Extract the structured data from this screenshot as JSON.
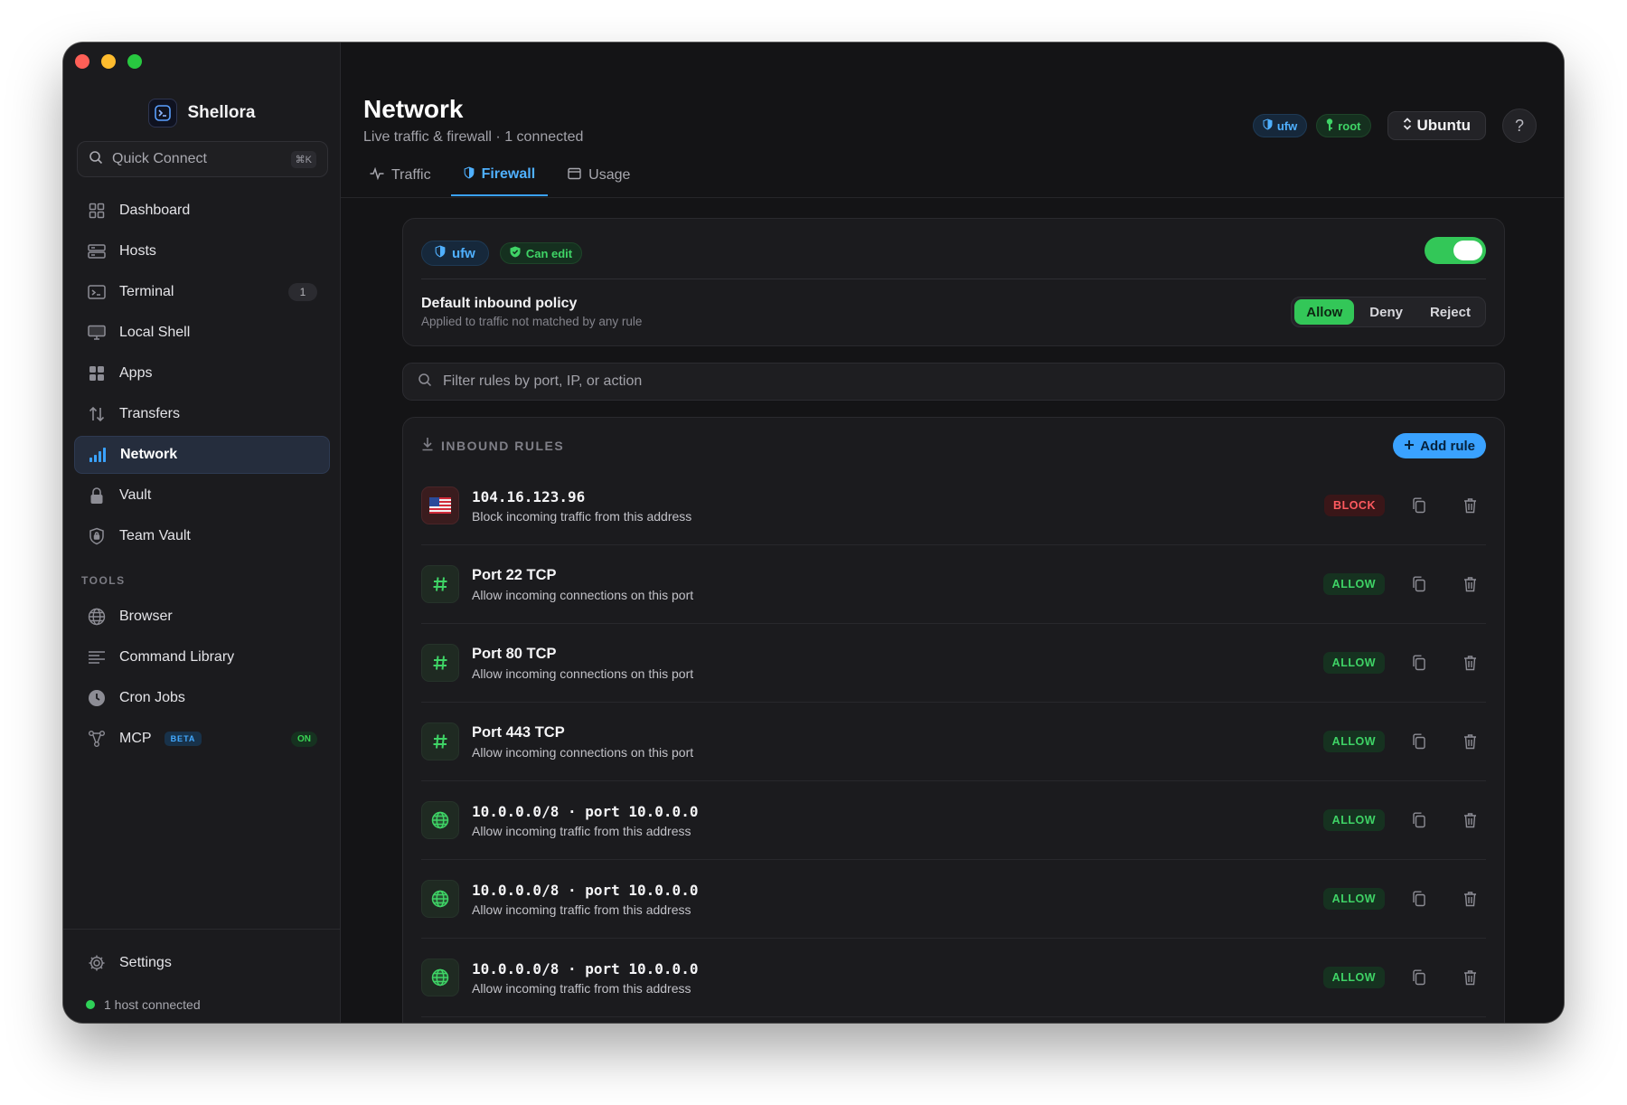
{
  "app": {
    "name": "Shellora"
  },
  "sidebar": {
    "quick_connect": {
      "label": "Quick Connect",
      "shortcut": "⌘K"
    },
    "items": [
      {
        "label": "Dashboard",
        "icon": "grid-icon"
      },
      {
        "label": "Hosts",
        "icon": "server-icon"
      },
      {
        "label": "Terminal",
        "icon": "terminal-icon",
        "count": "1"
      },
      {
        "label": "Local Shell",
        "icon": "monitor-icon"
      },
      {
        "label": "Apps",
        "icon": "apps-icon"
      },
      {
        "label": "Transfers",
        "icon": "transfer-icon"
      },
      {
        "label": "Network",
        "icon": "signal-bars-icon",
        "active": true
      },
      {
        "label": "Vault",
        "icon": "lock-icon"
      },
      {
        "label": "Team Vault",
        "icon": "shield-lock-icon"
      }
    ],
    "tools_header": "TOOLS",
    "tools": [
      {
        "label": "Browser",
        "icon": "globe-icon"
      },
      {
        "label": "Command Library",
        "icon": "list-icon"
      },
      {
        "label": "Cron Jobs",
        "icon": "clock-icon"
      },
      {
        "label": "MCP",
        "icon": "nodes-icon",
        "badge": "BETA",
        "status": "ON"
      }
    ],
    "settings_label": "Settings",
    "host_status": "1 host connected"
  },
  "header": {
    "title": "Network",
    "subtitle": "Live traffic & firewall · 1 connected",
    "ufw_pill": "ufw",
    "root_pill": "root",
    "os_label": "Ubuntu",
    "help_label": "?"
  },
  "tabs": [
    {
      "label": "Traffic",
      "icon": "pulse-icon"
    },
    {
      "label": "Firewall",
      "icon": "shield-icon",
      "active": true
    },
    {
      "label": "Usage",
      "icon": "calendar-icon"
    }
  ],
  "firewall": {
    "engine": "ufw",
    "permission": "Can edit",
    "enabled": true,
    "policy_title": "Default inbound policy",
    "policy_subtitle": "Applied to traffic not matched by any rule",
    "policy_options": [
      "Allow",
      "Deny",
      "Reject"
    ],
    "policy_selected": "Allow",
    "filter_placeholder": "Filter rules by port, IP, or action",
    "rules_title": "INBOUND RULES",
    "add_rule_label": "Add rule",
    "rules": [
      {
        "title": "104.16.123.96",
        "subtitle": "Block incoming traffic from this address",
        "action": "BLOCK",
        "icon": "us-flag-icon",
        "mono": true
      },
      {
        "title": "Port 22 TCP",
        "subtitle": "Allow incoming connections on this port",
        "action": "ALLOW",
        "icon": "hash-icon",
        "mono": false
      },
      {
        "title": "Port 80 TCP",
        "subtitle": "Allow incoming connections on this port",
        "action": "ALLOW",
        "icon": "hash-icon",
        "mono": false
      },
      {
        "title": "Port 443 TCP",
        "subtitle": "Allow incoming connections on this port",
        "action": "ALLOW",
        "icon": "hash-icon",
        "mono": false
      },
      {
        "title": "10.0.0.0/8 · port 10.0.0.0",
        "subtitle": "Allow incoming traffic from this address",
        "action": "ALLOW",
        "icon": "globe-icon",
        "mono": true
      },
      {
        "title": "10.0.0.0/8 · port 10.0.0.0",
        "subtitle": "Allow incoming traffic from this address",
        "action": "ALLOW",
        "icon": "globe-icon",
        "mono": true
      },
      {
        "title": "10.0.0.0/8 · port 10.0.0.0",
        "subtitle": "Allow incoming traffic from this address",
        "action": "ALLOW",
        "icon": "globe-icon",
        "mono": true
      }
    ]
  },
  "colors": {
    "accent_blue": "#3aa2ff",
    "allow_green": "#3fd466",
    "block_red": "#ff5a5f",
    "toggle_on": "#33c758"
  }
}
